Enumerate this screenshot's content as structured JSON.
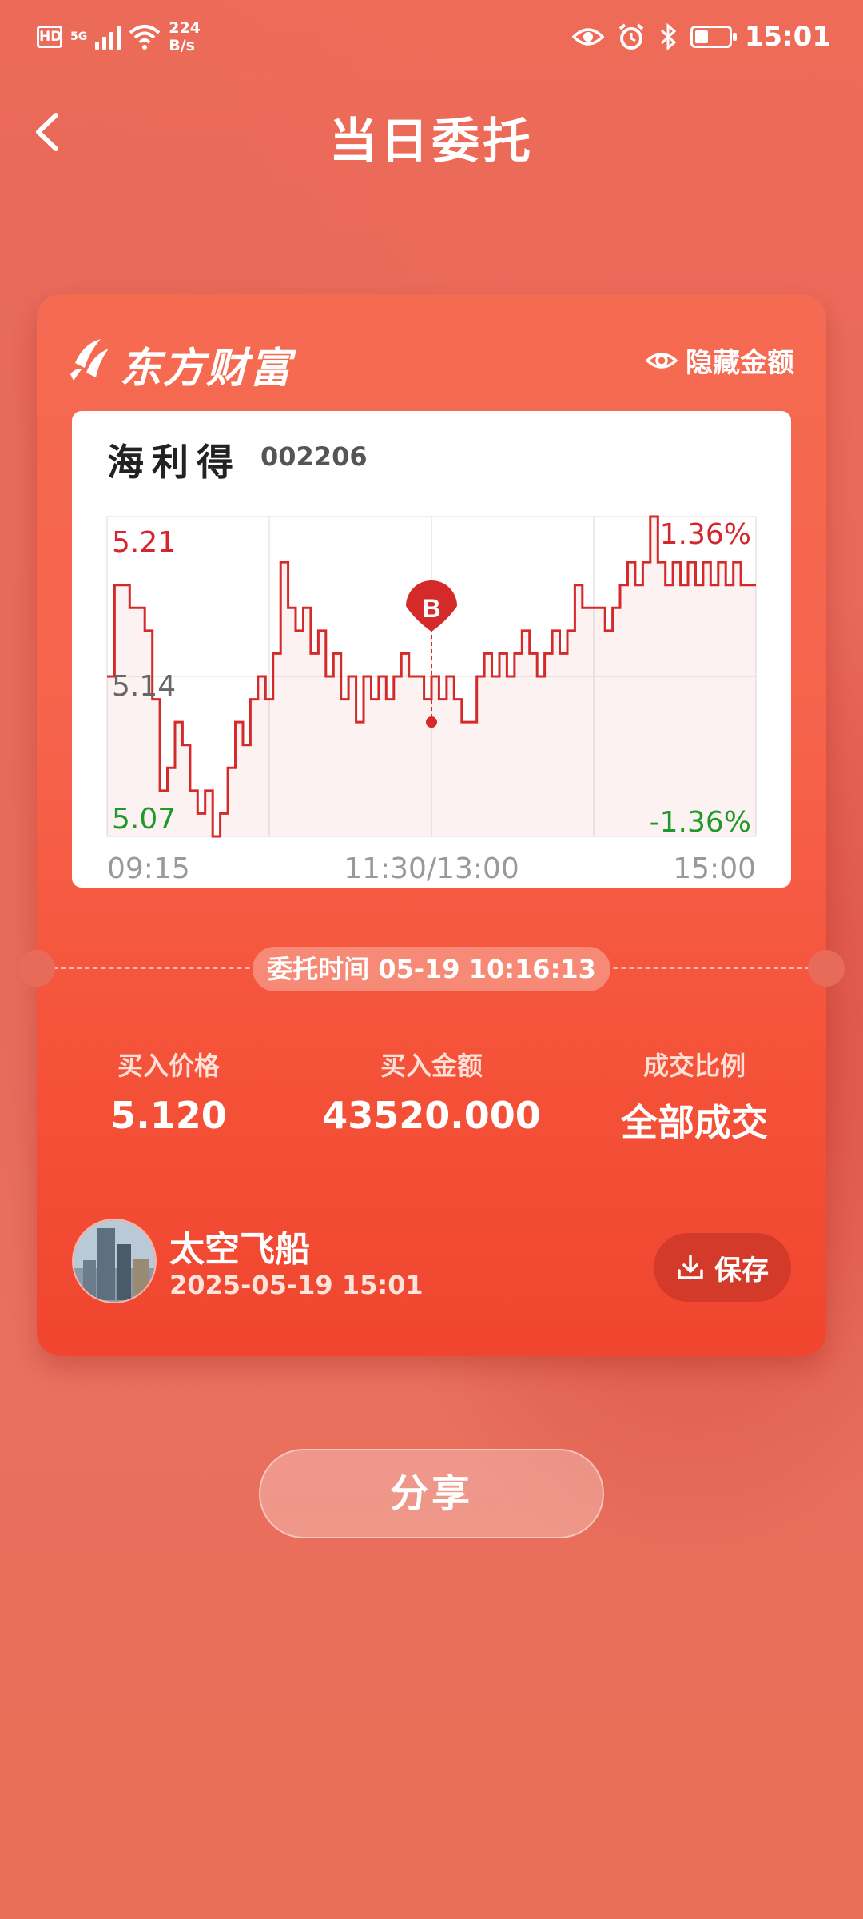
{
  "status_bar": {
    "hd": "HD",
    "network": "5G",
    "speed_value": "224",
    "speed_unit": "B/s",
    "time": "15:01",
    "icons": [
      "eye-icon",
      "alarm-icon",
      "bluetooth-icon",
      "battery-icon"
    ]
  },
  "header": {
    "title": "当日委托"
  },
  "card": {
    "brand": "东方财富",
    "hide_amount_label": "隐藏金额",
    "stock": {
      "name": "海利得",
      "code": "002206"
    },
    "order_time": "委托时间 05-19 10:16:13",
    "stats": [
      {
        "label": "买入价格",
        "value": "5.120"
      },
      {
        "label": "买入金额",
        "value": "43520.000"
      },
      {
        "label": "成交比例",
        "value": "全部成交"
      }
    ],
    "user": {
      "name": "太空飞船",
      "time": "2025-05-19 15:01"
    },
    "save_label": "保存"
  },
  "share_label": "分享",
  "colors": {
    "up": "#d6262d",
    "down": "#1f9a2a",
    "line": "#d42a2a",
    "accent": "#f5533a"
  },
  "chart_data": {
    "type": "line",
    "x_ticks": [
      "09:15",
      "11:30/13:00",
      "15:00"
    ],
    "y_ticks": {
      "top": "5.21",
      "mid": "5.14",
      "bottom": "5.07"
    },
    "pct_labels": {
      "top": "1.36%",
      "bottom": "-1.36%"
    },
    "ylim": [
      5.07,
      5.21
    ],
    "marker": {
      "label": "B",
      "price": 5.12
    },
    "series": [
      {
        "values": [
          5.14,
          5.18,
          5.18,
          5.17,
          5.17,
          5.16,
          5.13,
          5.09,
          5.1,
          5.12,
          5.11,
          5.09,
          5.08,
          5.09,
          5.07,
          5.08,
          5.1,
          5.12,
          5.11,
          5.13,
          5.14,
          5.13,
          5.15,
          5.19,
          5.17,
          5.16,
          5.17,
          5.15,
          5.16,
          5.14,
          5.15,
          5.13,
          5.14,
          5.12,
          5.14,
          5.13,
          5.14,
          5.13,
          5.14,
          5.15,
          5.14,
          5.14,
          5.13,
          5.14,
          5.13,
          5.14,
          5.13,
          5.12,
          5.12,
          5.14,
          5.15,
          5.14,
          5.15,
          5.14,
          5.15,
          5.16,
          5.15,
          5.14,
          5.15,
          5.16,
          5.15,
          5.16,
          5.18,
          5.17,
          5.17,
          5.17,
          5.16,
          5.17,
          5.18,
          5.19,
          5.18,
          5.19,
          5.21,
          5.19,
          5.18,
          5.19,
          5.18,
          5.19,
          5.18,
          5.19,
          5.18,
          5.19,
          5.18,
          5.19,
          5.18,
          5.18
        ]
      }
    ]
  }
}
